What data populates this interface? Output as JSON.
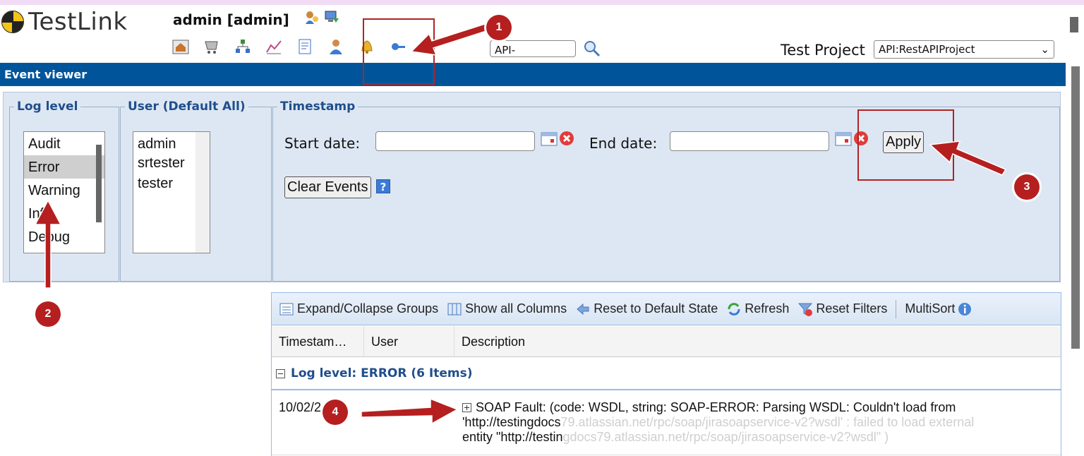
{
  "app": {
    "logo_text": "TestLink",
    "user": "admin [admin]"
  },
  "header": {
    "search_value": "API-",
    "project_label": "Test Project",
    "project_selected": "API:RestAPIProject",
    "icons": [
      "home-icon",
      "desktop-icon",
      "cart-icon",
      "tree-icon",
      "chart-icon",
      "document-icon",
      "user-icon",
      "bell-icon",
      "key-icon",
      "search-icon"
    ]
  },
  "page": {
    "title": "Event viewer"
  },
  "filters": {
    "log_level": {
      "legend": "Log level",
      "options": [
        "Audit",
        "Error",
        "Warning",
        "Info",
        "Debug"
      ],
      "selected": "Error"
    },
    "user": {
      "legend": "User (Default All)",
      "options": [
        "admin",
        "srtester",
        "tester"
      ]
    },
    "timestamp": {
      "legend": "Timestamp",
      "start_label": "Start date:",
      "end_label": "End date:",
      "apply_label": "Apply",
      "clear_events_label": "Clear Events",
      "help": "?"
    }
  },
  "grid": {
    "toolbar": {
      "expand": "Expand/Collapse Groups",
      "show_cols": "Show all Columns",
      "reset_state": "Reset to Default State",
      "refresh": "Refresh",
      "reset_filters": "Reset Filters",
      "multisort": "MultiSort"
    },
    "columns": [
      "Timestam…",
      "User",
      "Description"
    ],
    "group_label": "Log level: ERROR (6 Items)",
    "rows": [
      {
        "timestamp": "10/02/2",
        "desc_line1": "SOAP Fault: (code: WSDL, string: SOAP-ERROR: Parsing WSDL: Couldn't load from",
        "desc_line2a": "'http://testingdocs",
        "desc_line2b": "79.atlassian.net/rpc/soap/jirasoapservice-v2?wsdl' : failed to load external",
        "desc_line3a": "entity \"http://testin",
        "desc_line3b": "gdocs79.atlassian.net/rpc/soap/jirasoapservice-v2?wsdl\" )"
      }
    ]
  },
  "annotations": {
    "badges": [
      "1",
      "2",
      "3",
      "4"
    ],
    "color": "#b51f1f"
  },
  "colors": {
    "title_bar": "#00549a",
    "legend": "#1f4e8c",
    "panel": "#dde7f3"
  }
}
